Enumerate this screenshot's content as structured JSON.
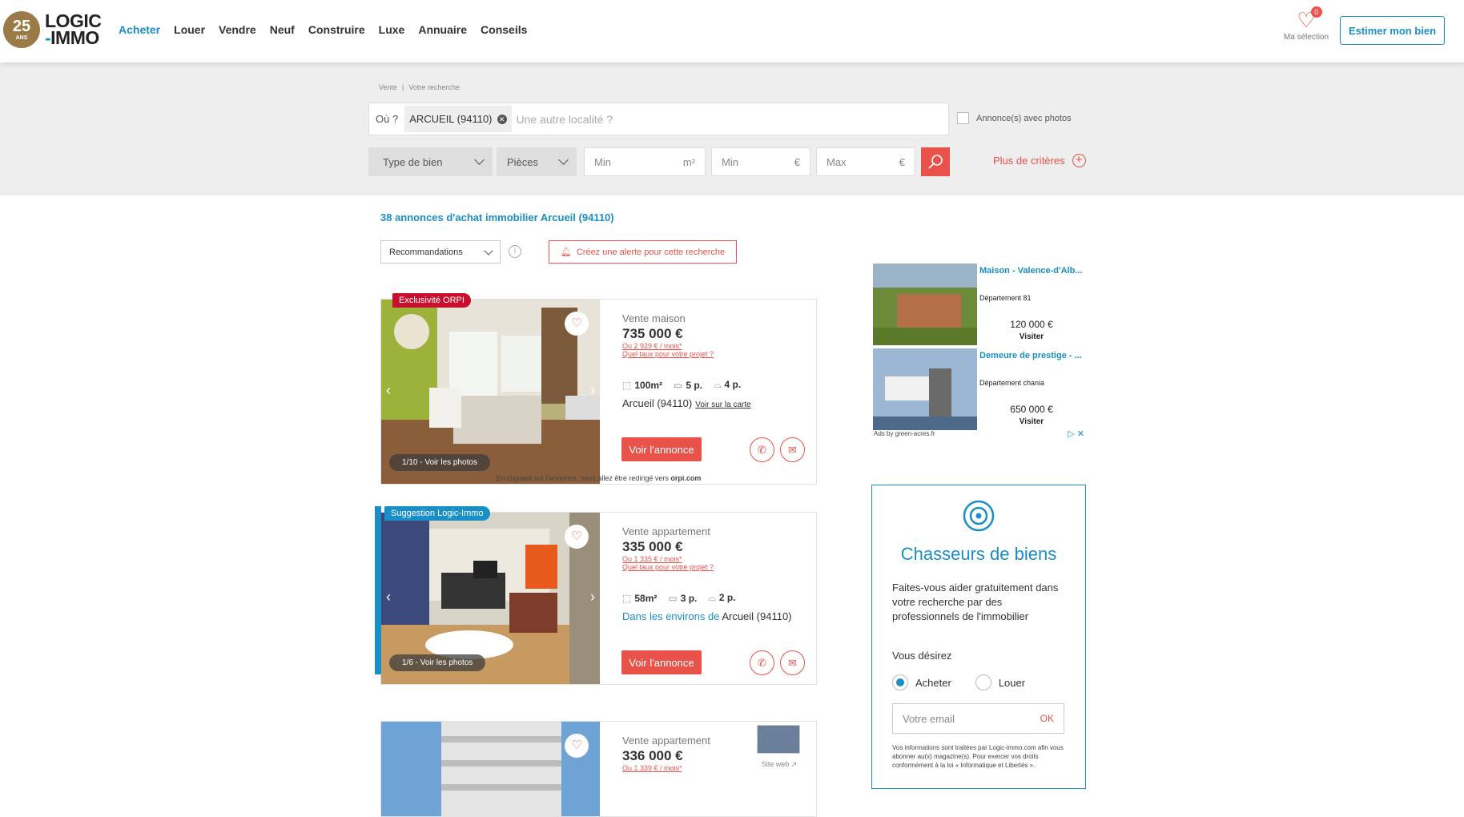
{
  "header": {
    "logo": {
      "badge_number": "25",
      "badge_sub": "ANS",
      "line1": "LOGIC",
      "line2_dash": "-",
      "line2": "IMMO"
    },
    "nav": [
      "Acheter",
      "Louer",
      "Vendre",
      "Neuf",
      "Construire",
      "Luxe",
      "Annuaire",
      "Conseils"
    ],
    "selection": {
      "count": "0",
      "label": "Ma sélection"
    },
    "estimer_label": "Estimer mon bien"
  },
  "search": {
    "breadcrumb": [
      "Vente",
      "Votre recherche"
    ],
    "where_label": "Où ?",
    "location_chip": "ARCUEIL (94110)",
    "location_placeholder": "Une autre localité ?",
    "photos_label": "Annonce(s) avec photos",
    "type_label": "Type de bien",
    "rooms_label": "Pièces",
    "surface_min": "Min",
    "surface_unit": "m²",
    "price_min": "Min",
    "price_max": "Max",
    "currency": "€",
    "more_label": "Plus de critères"
  },
  "results": {
    "title": "38 annonces d'achat immobilier Arcueil (94110)",
    "sort_label": "Recommandations",
    "alert_label": "Créez une alerte pour cette recherche",
    "listings": [
      {
        "badge": "Exclusivité ORPI",
        "photo_count": "1/10 - Voir les photos",
        "type": "Vente maison",
        "price": "735 000 €",
        "monthly": "Ou 2 929 € / mois*",
        "rate_link": "Quel taux pour votre projet ?",
        "surface": "100m²",
        "rooms": "5 p.",
        "bedrooms": "4 p.",
        "location": "Arcueil (94110)",
        "map_link": "Voir sur la carte",
        "cta": "Voir l'annonce",
        "redirect_prefix": "En cliquant sur l'annonce, vous allez être redirigé vers",
        "redirect_site": "orpi.com"
      },
      {
        "badge": "Suggestion Logic-Immo",
        "photo_count": "1/6 - Voir les photos",
        "type": "Vente appartement",
        "price": "335 000 €",
        "monthly": "Ou 1 335 € / mois*",
        "rate_link": "Quel taux pour votre projet ?",
        "surface": "58m²",
        "rooms": "3 p.",
        "bedrooms": "2 p.",
        "env_prefix": "Dans les environs de",
        "location": "Arcueil (94110)",
        "cta": "Voir l'annonce"
      },
      {
        "type": "Vente appartement",
        "price": "336 000 €",
        "monthly": "Ou 1 339 € / mois*",
        "site_label": "Site web"
      }
    ]
  },
  "ads": {
    "items": [
      {
        "title": "Maison - Valence-d'Alb...",
        "department": "Département 81",
        "price": "120 000 €",
        "cta": "Visiter"
      },
      {
        "title": "Demeure de prestige - ...",
        "department": "Département chania",
        "price": "650 000 €",
        "cta": "Visiter"
      }
    ],
    "by": "Ads by green-acres.fr"
  },
  "hunters": {
    "title": "Chasseurs de biens",
    "text": "Faites-vous aider gratuitement dans votre recherche par des professionnels de l'immobilier",
    "want": "Vous désirez",
    "option_buy": "Acheter",
    "option_rent": "Louer",
    "email_placeholder": "Votre email",
    "ok": "OK",
    "legal": "Vos informations sont traitées par Logic-immo.com afin vous abonner au(x) magazine(s). Pour exercer vos droits conformément à la loi « Informatique et Libertés »."
  },
  "colors": {
    "accent_blue": "#1a8ec6",
    "accent_red": "#e8524a",
    "exclusive_red": "#c8102e",
    "gold": "#9a7b47"
  }
}
